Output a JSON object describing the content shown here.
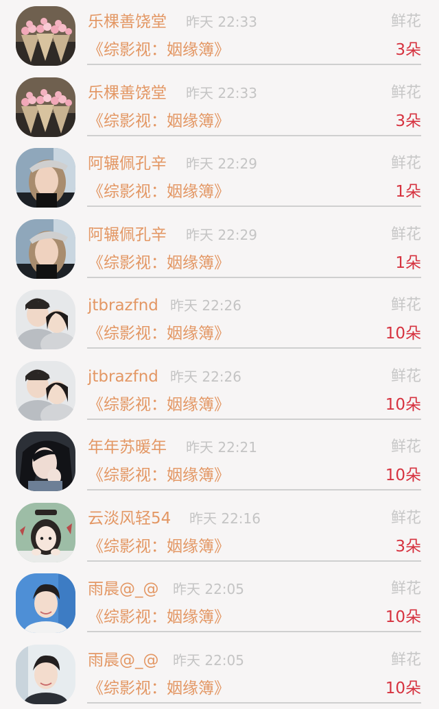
{
  "items": [
    {
      "name": "乐棵善饶堂",
      "time": "昨天 22:33",
      "gift": "鲜花",
      "book": "《综影视：姻缘簿》",
      "count": "3朵",
      "avatar": "flower-bouquet-avatar"
    },
    {
      "name": "乐棵善饶堂",
      "time": "昨天 22:33",
      "gift": "鲜花",
      "book": "《综影视：姻缘簿》",
      "count": "3朵",
      "avatar": "flower-bouquet-avatar"
    },
    {
      "name": "阿辗佩孔辛",
      "time": "昨天 22:29",
      "gift": "鲜花",
      "book": "《综影视：姻缘簿》",
      "count": "1朵",
      "avatar": "girl-cap-avatar"
    },
    {
      "name": "阿辗佩孔辛",
      "time": "昨天 22:29",
      "gift": "鲜花",
      "book": "《综影视：姻缘簿》",
      "count": "1朵",
      "avatar": "girl-cap-avatar"
    },
    {
      "name": "jtbrazfnd",
      "time": "昨天 22:26",
      "gift": "鲜花",
      "book": "《综影视：姻缘簿》",
      "count": "10朵",
      "avatar": "couple-avatar"
    },
    {
      "name": "jtbrazfnd",
      "time": "昨天 22:26",
      "gift": "鲜花",
      "book": "《综影视：姻缘簿》",
      "count": "10朵",
      "avatar": "couple-avatar"
    },
    {
      "name": "年年苏暖年",
      "time": "昨天 22:21",
      "gift": "鲜花",
      "book": "《综影视：姻缘簿》",
      "count": "10朵",
      "avatar": "woman-portrait-avatar"
    },
    {
      "name": "云淡风轻54",
      "time": "昨天 22:16",
      "gift": "鲜花",
      "book": "《综影视：姻缘簿》",
      "count": "3朵",
      "avatar": "cartoon-girl-avatar"
    },
    {
      "name": "雨晨@_@",
      "time": "昨天 22:05",
      "gift": "鲜花",
      "book": "《综影视：姻缘簿》",
      "count": "10朵",
      "avatar": "young-man-avatar"
    },
    {
      "name": "雨晨@_@",
      "time": "昨天 22:05",
      "gift": "鲜花",
      "book": "《综影视：姻缘簿》",
      "count": "10朵",
      "avatar": "young-man-avatar"
    }
  ],
  "colors": {
    "name": "#e39764",
    "count": "#d6323f",
    "muted": "#c4c4c4",
    "background": "#f7f5f5"
  }
}
